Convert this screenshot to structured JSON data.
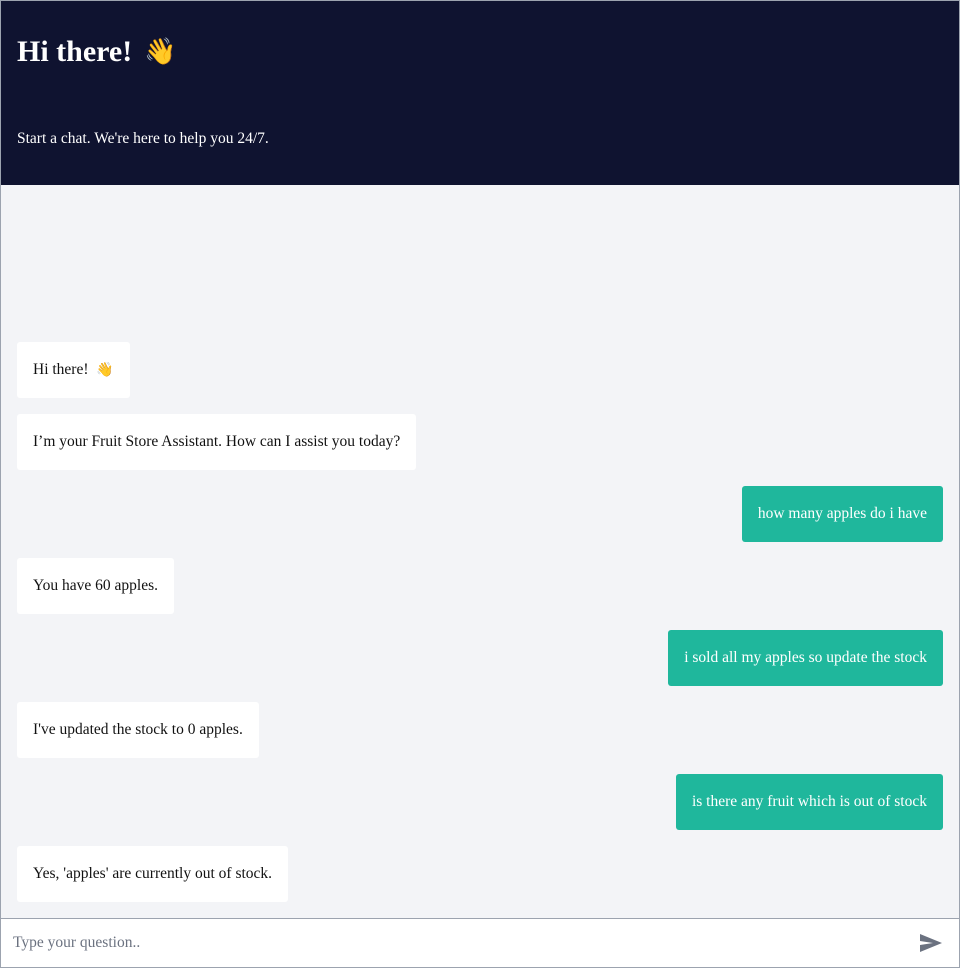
{
  "header": {
    "title": "Hi there!",
    "title_emoji": "👋",
    "subtitle": "Start a chat. We're here to help you 24/7."
  },
  "messages": [
    {
      "role": "bot",
      "text": "Hi there!",
      "emoji": "👋"
    },
    {
      "role": "bot",
      "text": "I’m your Fruit Store Assistant. How can I assist you today?"
    },
    {
      "role": "user",
      "text": "how many apples do i have"
    },
    {
      "role": "bot",
      "text": "You have 60 apples."
    },
    {
      "role": "user",
      "text": "i sold all my apples so update the stock"
    },
    {
      "role": "bot",
      "text": "I've updated the stock to 0 apples."
    },
    {
      "role": "user",
      "text": "is there any fruit which is out of stock"
    },
    {
      "role": "bot",
      "text": "Yes, 'apples' are currently out of stock."
    }
  ],
  "composer": {
    "placeholder": "Type your question..",
    "value": "",
    "send_icon": "send-icon"
  },
  "colors": {
    "header_bg": "#0f1330",
    "chat_bg": "#f3f4f7",
    "user_bubble": "#1fb79c",
    "bot_bubble": "#ffffff"
  }
}
